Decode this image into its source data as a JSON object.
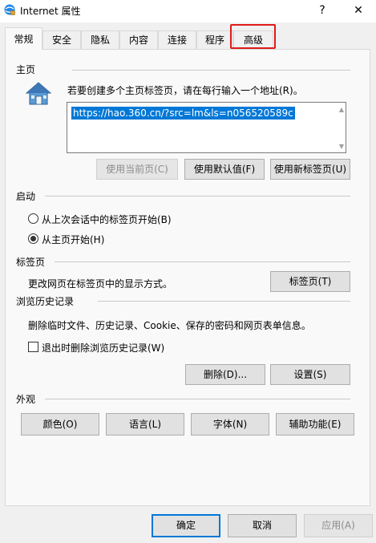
{
  "window": {
    "title": "Internet 属性",
    "help_glyph": "?",
    "close_glyph": "✕"
  },
  "tabs": [
    "常规",
    "安全",
    "隐私",
    "内容",
    "连接",
    "程序",
    "高级"
  ],
  "active_tab": "常规",
  "highlighted_tab": "高级",
  "highlight_color": "#e01a1a",
  "home": {
    "section": "主页",
    "instruction": "若要创建多个主页标签页，请在每行输入一个地址(R)。",
    "url": "https://hao.360.cn/?src=lm&ls=n056520589c",
    "buttons": {
      "use_current": "使用当前页(C)",
      "use_default": "使用默认值(F)",
      "use_new_tab": "使用新标签页(U)"
    }
  },
  "startup": {
    "section": "启动",
    "options": [
      "从上次会话中的标签页开始(B)",
      "从主页开始(H)"
    ],
    "selected_index": 1
  },
  "tabs_section": {
    "section": "标签页",
    "description": "更改网页在标签页中的显示方式。",
    "button": "标签页(T)"
  },
  "history": {
    "section": "浏览历史记录",
    "description": "删除临时文件、历史记录、Cookie、保存的密码和网页表单信息。",
    "checkbox_label": "退出时删除浏览历史记录(W)",
    "checkbox_checked": false,
    "delete_button": "删除(D)...",
    "settings_button": "设置(S)"
  },
  "appearance": {
    "section": "外观",
    "buttons": [
      "颜色(O)",
      "语言(L)",
      "字体(N)",
      "辅助功能(E)"
    ]
  },
  "footer": {
    "ok": "确定",
    "cancel": "取消",
    "apply": "应用(A)"
  },
  "colors": {
    "selection": "#0078d7",
    "primary_border": "#0078d7"
  }
}
